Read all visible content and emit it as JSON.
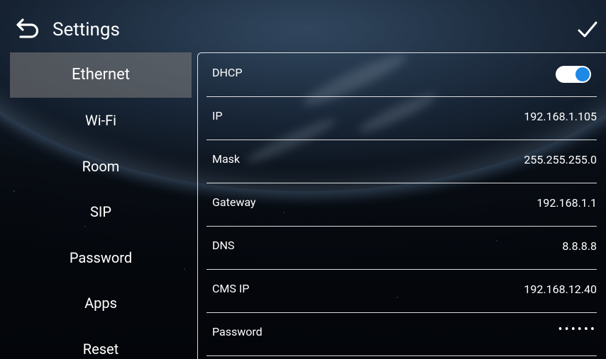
{
  "header": {
    "title": "Settings"
  },
  "sidebar": {
    "items": [
      {
        "label": "Ethernet",
        "active": true
      },
      {
        "label": "Wi-Fi",
        "active": false
      },
      {
        "label": "Room",
        "active": false
      },
      {
        "label": "SIP",
        "active": false
      },
      {
        "label": "Password",
        "active": false
      },
      {
        "label": "Apps",
        "active": false
      },
      {
        "label": "Reset",
        "active": false
      }
    ]
  },
  "ethernet": {
    "dhcp": {
      "label": "DHCP",
      "enabled": true
    },
    "ip": {
      "label": "IP",
      "value": "192.168.1.105"
    },
    "mask": {
      "label": "Mask",
      "value": "255.255.255.0"
    },
    "gateway": {
      "label": "Gateway",
      "value": "192.168.1.1"
    },
    "dns": {
      "label": "DNS",
      "value": "8.8.8.8"
    },
    "cms_ip": {
      "label": "CMS IP",
      "value": "192.168.12.40"
    },
    "password": {
      "label": "Password",
      "value": "••••••"
    }
  },
  "colors": {
    "toggle_knob": "#1e88e5",
    "active_item_bg": "#787878"
  },
  "icons": {
    "back": "back-arrow-icon",
    "confirm": "checkmark-icon"
  }
}
